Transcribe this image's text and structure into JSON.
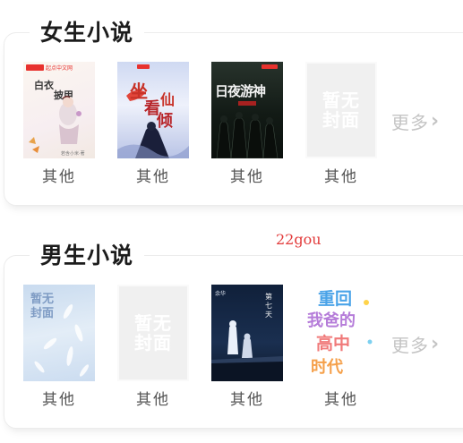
{
  "female": {
    "title": "女生小说",
    "books": [
      {
        "label": "其他",
        "cover_text": "白衣\n披甲",
        "publisher": "起点中文网"
      },
      {
        "label": "其他",
        "cover_text": "坐看仙倾"
      },
      {
        "label": "其他",
        "cover_text": "日夜游神"
      },
      {
        "label": "其他",
        "cover_text": "暂无\n封面"
      }
    ],
    "more_label": "更多"
  },
  "male": {
    "title": "男生小说",
    "books": [
      {
        "label": "其他",
        "cover_text": "暂无\n封面"
      },
      {
        "label": "其他",
        "cover_text": "暂无\n封面"
      },
      {
        "label": "其他",
        "cover_text": "第七天"
      },
      {
        "label": "其他",
        "cover_text": "重回我爸的高中时代"
      }
    ],
    "more_label": "更多"
  },
  "watermark": "22gou",
  "colors": {
    "more_gray": "#c4c4c4",
    "label_gray": "#555555",
    "watermark_red": "#e23a3a"
  }
}
